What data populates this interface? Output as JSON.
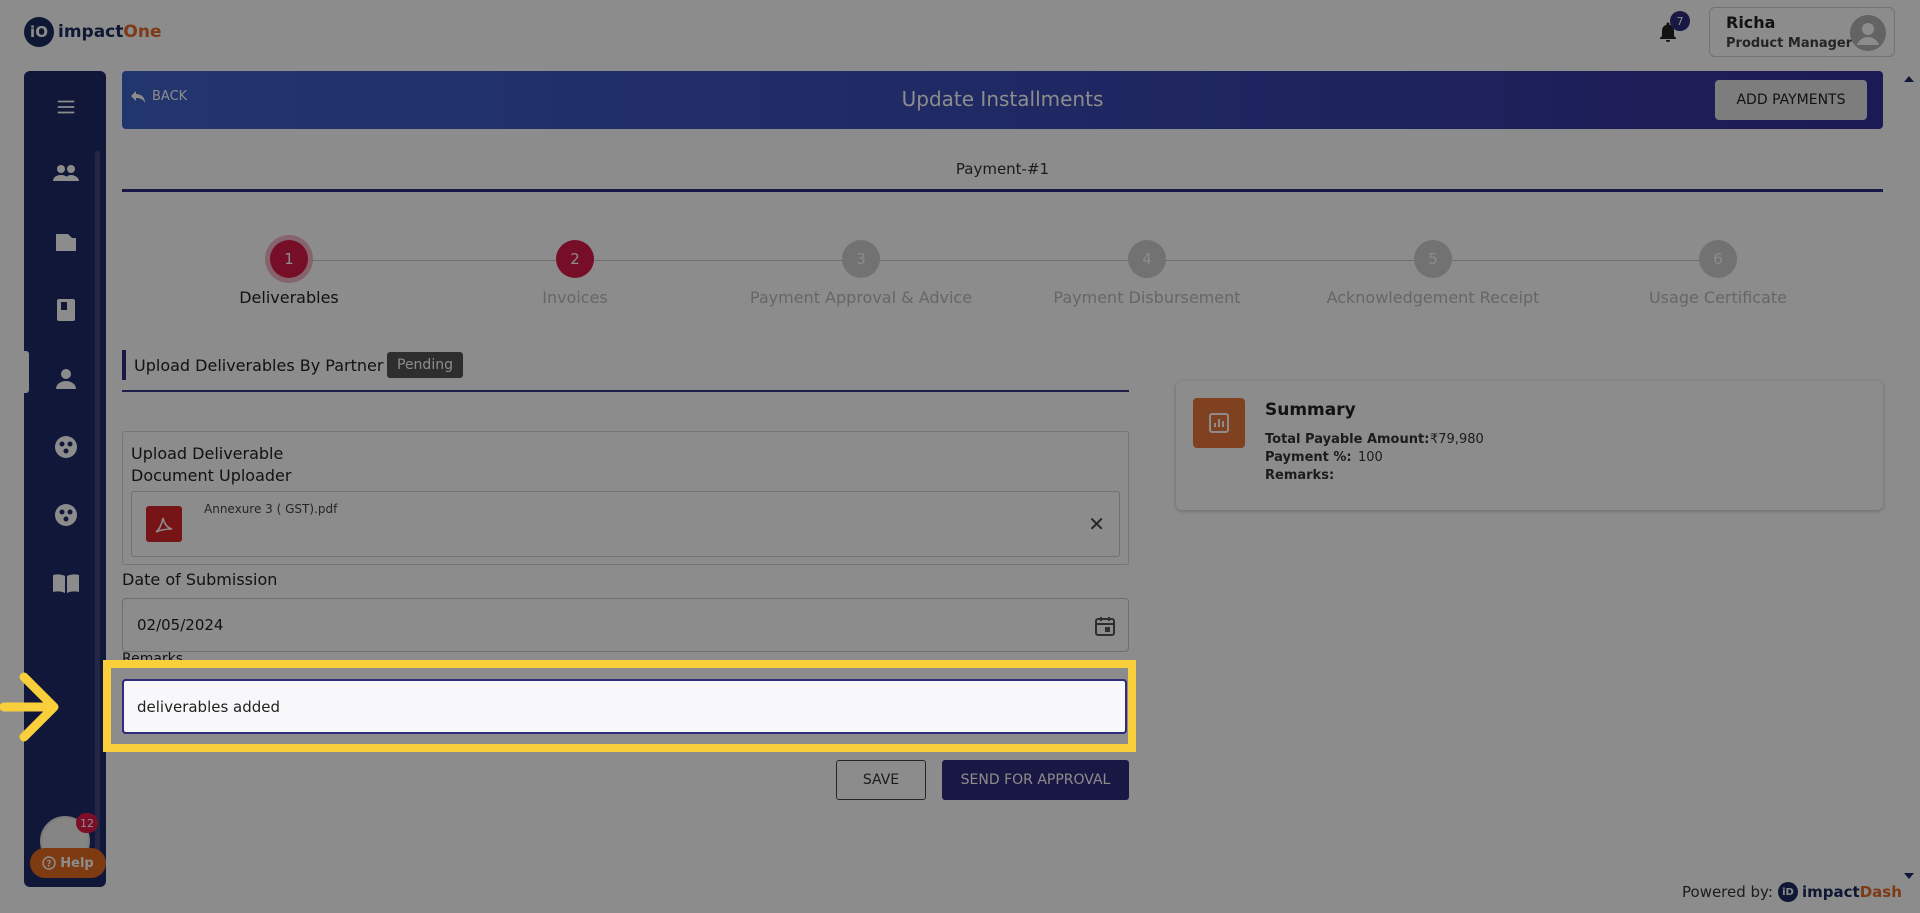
{
  "app": {
    "logo_prefix": "iO",
    "logo_name_a": "impact",
    "logo_name_b": "One"
  },
  "notifications": {
    "count": "7"
  },
  "user": {
    "name": "Richa",
    "role": "Product Manager"
  },
  "sidebar": {
    "items": [
      {
        "icon": "menu-icon"
      },
      {
        "icon": "people-icon"
      },
      {
        "icon": "folder-icon"
      },
      {
        "icon": "book-icon",
        "active": true
      },
      {
        "icon": "person-icon"
      },
      {
        "icon": "group-circle-icon"
      },
      {
        "icon": "group-circle-icon"
      },
      {
        "icon": "open-book-icon"
      }
    ],
    "help_badge": "12",
    "help_label": "Help"
  },
  "header": {
    "back_label": "BACK",
    "title": "Update Installments",
    "add_payments_label": "ADD PAYMENTS"
  },
  "payment_tab": {
    "label": "Payment-#1"
  },
  "stepper": {
    "steps": [
      {
        "number": "1",
        "label": "Deliverables",
        "state": "active"
      },
      {
        "number": "2",
        "label": "Invoices",
        "state": "current"
      },
      {
        "number": "3",
        "label": "Payment Approval & Advice",
        "state": "pending"
      },
      {
        "number": "4",
        "label": "Payment Disbursement",
        "state": "pending"
      },
      {
        "number": "5",
        "label": "Acknowledgement Receipt",
        "state": "pending"
      },
      {
        "number": "6",
        "label": "Usage Certificate",
        "state": "pending"
      }
    ]
  },
  "form": {
    "section_title": "Upload Deliverables By Partner",
    "status_badge": "Pending",
    "upload_title": "Upload Deliverable",
    "uploader_label": "Document Uploader",
    "file_name": "Annexure 3 ( GST).pdf",
    "date_label": "Date of Submission",
    "date_value": "02/05/2024",
    "remarks_label": "Remarks",
    "remarks_value": "deliverables added",
    "save_label": "SAVE",
    "send_label": "SEND FOR APPROVAL"
  },
  "summary": {
    "title": "Summary",
    "rows": [
      {
        "label": "Total Payable Amount:",
        "value": "₹79,980"
      },
      {
        "label": "Payment %:",
        "value": "100"
      },
      {
        "label": "Remarks:",
        "value": ""
      }
    ]
  },
  "footer": {
    "powered_by": "Powered by:",
    "brand_prefix": "iD",
    "brand_a": "impact",
    "brand_b": "Dash"
  },
  "colors": {
    "primary": "#2f2b7d",
    "sidebar": "#1f2b68",
    "step_active": "#d81b4a",
    "highlight": "#f9cf3b",
    "accent_orange": "#e8773a"
  }
}
